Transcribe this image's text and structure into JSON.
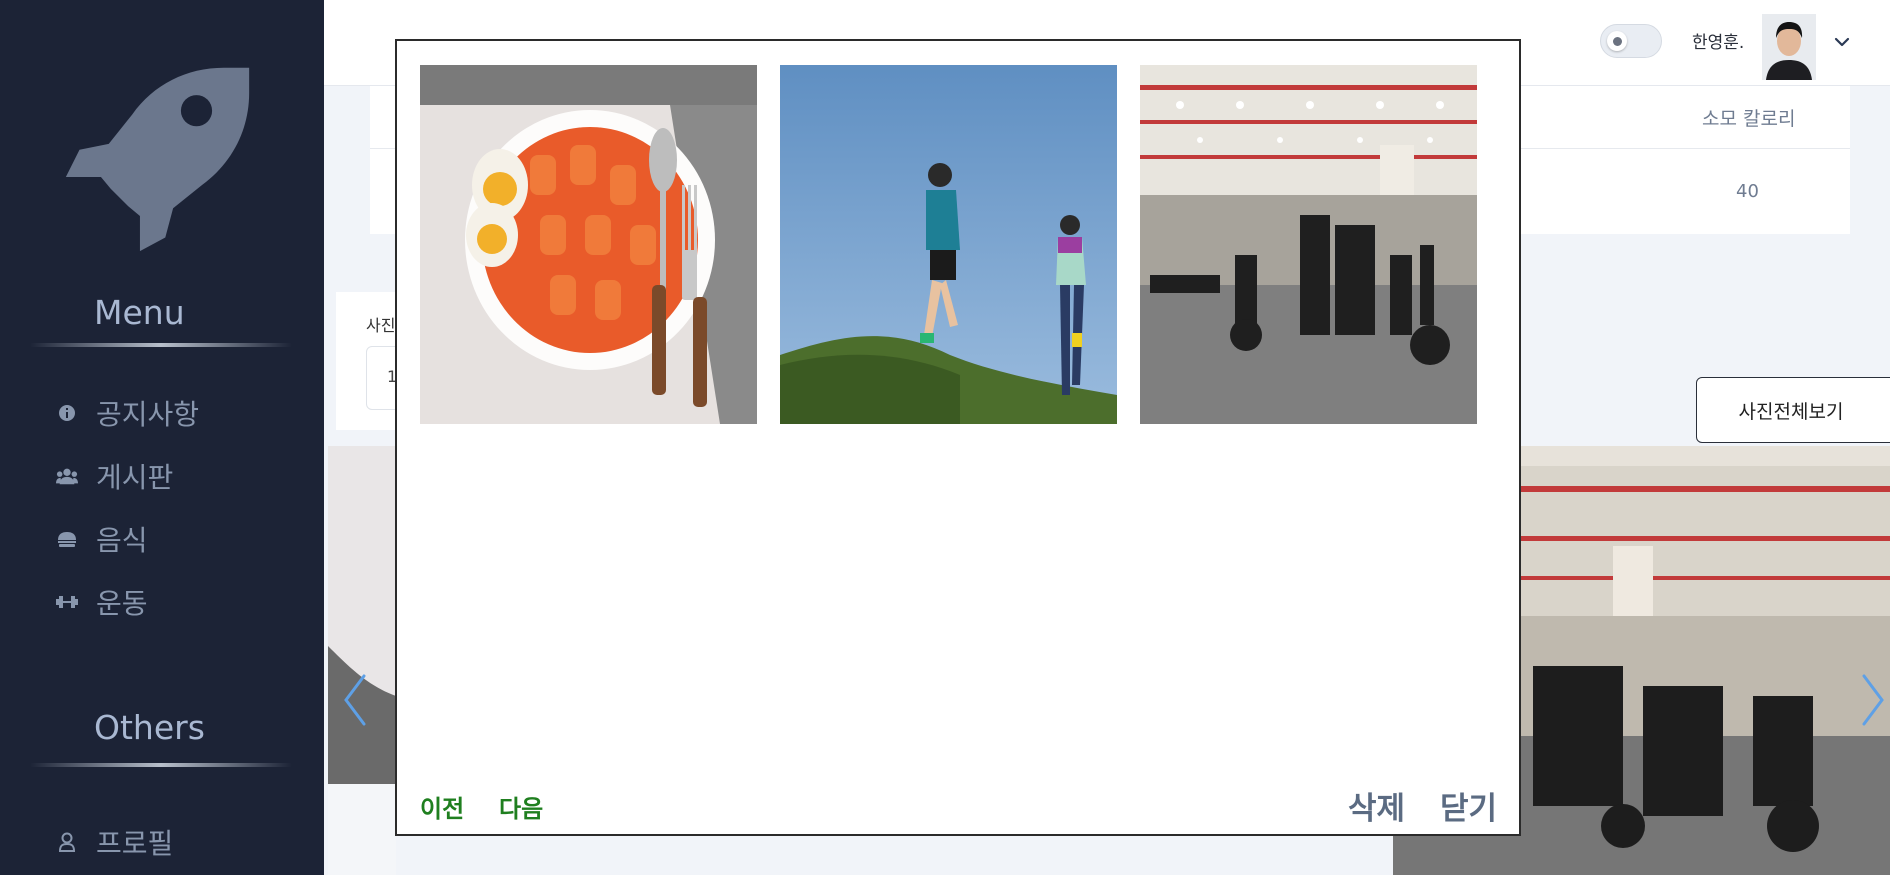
{
  "sidebar": {
    "menu_title": "Menu",
    "others_title": "Others",
    "items": [
      {
        "label": "공지사항",
        "icon": "info-icon"
      },
      {
        "label": "게시판",
        "icon": "users-icon"
      },
      {
        "label": "음식",
        "icon": "food-icon"
      },
      {
        "label": "운동",
        "icon": "dumbbell-icon"
      }
    ],
    "others": [
      {
        "label": "프로필",
        "icon": "user-icon"
      }
    ]
  },
  "header": {
    "username": "한영훈."
  },
  "page": {
    "table_header_calories": "소모 칼로리",
    "table_value_calories": "40",
    "photo_label": "사진",
    "photo_input_value": "1",
    "view_all_button": "사진전체보기"
  },
  "modal": {
    "prev_label": "이전",
    "next_label": "다음",
    "delete_label": "삭제",
    "close_label": "닫기",
    "photos": [
      {
        "alt": "tteokbokki"
      },
      {
        "alt": "runners"
      },
      {
        "alt": "gym"
      }
    ]
  },
  "colors": {
    "sidebar_bg": "#1c2336",
    "nav_text": "#8896ad",
    "nav_green": "#1f7f1f",
    "action_gray": "#5b6b82"
  }
}
